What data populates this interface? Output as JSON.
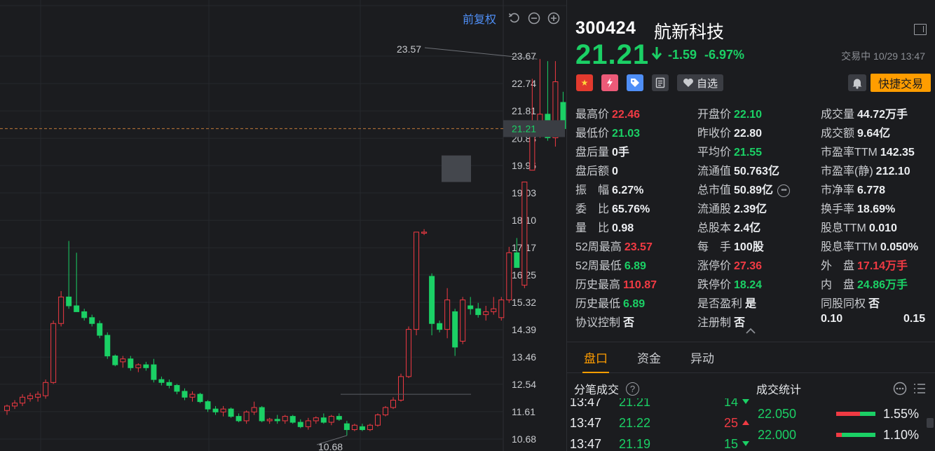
{
  "chart_toolbar": {
    "adjust_label": "前复权"
  },
  "chart_data": {
    "type": "candlestick",
    "y_ticks": [
      23.67,
      22.74,
      21.81,
      20.88,
      19.96,
      19.03,
      18.1,
      17.17,
      16.25,
      15.32,
      14.39,
      13.46,
      12.54,
      11.61,
      10.68
    ],
    "ylim": [
      10.68,
      23.67
    ],
    "current_price": 21.21,
    "max_label": "23.57",
    "min_label": "10.68",
    "colors": {
      "up": "#f03a43",
      "down": "#1bd065",
      "grid": "#26282c",
      "axis_text": "#c9cbcf"
    },
    "candles": [
      [
        11.65,
        11.85,
        11.5,
        11.8
      ],
      [
        11.8,
        12.0,
        11.7,
        11.9
      ],
      [
        11.9,
        12.2,
        11.8,
        12.1
      ],
      [
        12.05,
        12.25,
        11.95,
        12.15
      ],
      [
        12.1,
        12.3,
        11.95,
        12.2
      ],
      [
        12.15,
        12.7,
        12.05,
        12.6
      ],
      [
        12.6,
        14.7,
        12.55,
        14.6
      ],
      [
        14.6,
        15.7,
        14.5,
        15.5
      ],
      [
        15.5,
        17.4,
        15.1,
        15.2
      ],
      [
        15.2,
        17.0,
        15.0,
        15.0
      ],
      [
        15.0,
        15.1,
        14.7,
        14.8
      ],
      [
        14.8,
        14.9,
        14.5,
        14.6
      ],
      [
        14.6,
        14.7,
        14.1,
        14.2
      ],
      [
        14.2,
        14.3,
        13.4,
        13.5
      ],
      [
        13.5,
        13.55,
        13.15,
        13.2
      ],
      [
        13.3,
        13.5,
        13.1,
        13.4
      ],
      [
        13.4,
        13.5,
        13.0,
        13.1
      ],
      [
        13.1,
        13.25,
        12.95,
        13.2
      ],
      [
        13.2,
        13.3,
        13.0,
        13.1
      ],
      [
        13.2,
        13.4,
        12.6,
        12.7
      ],
      [
        12.7,
        12.8,
        12.5,
        12.6
      ],
      [
        12.6,
        12.7,
        12.4,
        12.5
      ],
      [
        12.5,
        12.55,
        12.2,
        12.3
      ],
      [
        12.3,
        12.4,
        12.0,
        12.1
      ],
      [
        12.1,
        12.3,
        11.95,
        12.2
      ],
      [
        12.2,
        12.25,
        11.9,
        11.95
      ],
      [
        11.95,
        12.0,
        11.6,
        11.7
      ],
      [
        11.7,
        11.8,
        11.5,
        11.6
      ],
      [
        11.6,
        11.8,
        11.45,
        11.7
      ],
      [
        11.7,
        11.75,
        11.4,
        11.45
      ],
      [
        11.45,
        11.55,
        11.25,
        11.3
      ],
      [
        11.3,
        11.65,
        11.2,
        11.6
      ],
      [
        11.6,
        11.95,
        11.5,
        11.75
      ],
      [
        11.75,
        11.8,
        11.25,
        11.3
      ],
      [
        11.3,
        11.4,
        11.2,
        11.35
      ],
      [
        11.35,
        11.5,
        11.2,
        11.3
      ],
      [
        11.3,
        11.5,
        11.2,
        11.45
      ],
      [
        11.45,
        11.5,
        11.2,
        11.25
      ],
      [
        11.25,
        11.35,
        11.05,
        11.1
      ],
      [
        11.1,
        11.4,
        11.0,
        11.3
      ],
      [
        11.3,
        11.45,
        11.2,
        11.4
      ],
      [
        11.4,
        11.55,
        11.2,
        11.25
      ],
      [
        11.25,
        11.5,
        11.15,
        11.45
      ],
      [
        11.45,
        11.55,
        11.3,
        11.35
      ],
      [
        11.2,
        11.3,
        10.8,
        11.0
      ],
      [
        11.0,
        11.2,
        10.95,
        11.15
      ],
      [
        11.1,
        11.2,
        10.95,
        11.0
      ],
      [
        11.0,
        11.2,
        10.95,
        11.15
      ],
      [
        11.15,
        11.55,
        11.1,
        11.5
      ],
      [
        11.5,
        11.8,
        11.45,
        11.75
      ],
      [
        11.75,
        12.1,
        11.7,
        12.0
      ],
      [
        12.0,
        12.9,
        11.95,
        12.8
      ],
      [
        12.8,
        14.5,
        12.75,
        14.4
      ],
      [
        14.4,
        17.7,
        14.2,
        17.7
      ],
      [
        17.7,
        17.8,
        17.6,
        17.7
      ],
      [
        16.2,
        16.3,
        14.2,
        14.6
      ],
      [
        14.6,
        14.7,
        14.3,
        14.4
      ],
      [
        14.4,
        15.8,
        14.1,
        15.4
      ],
      [
        15.0,
        15.1,
        13.5,
        13.8
      ],
      [
        14.0,
        15.5,
        13.9,
        15.4
      ],
      [
        15.2,
        15.5,
        14.9,
        15.1
      ],
      [
        15.1,
        15.3,
        14.8,
        14.9
      ],
      [
        14.9,
        15.2,
        14.7,
        15.0
      ],
      [
        15.0,
        15.5,
        14.9,
        15.1
      ],
      [
        14.8,
        15.5,
        14.7,
        15.4
      ],
      [
        15.4,
        17.2,
        15.3,
        17.0
      ],
      [
        17.0,
        17.5,
        16.5,
        16.5
      ],
      [
        15.9,
        19.4,
        15.8,
        19.4
      ],
      [
        19.8,
        22.9,
        19.8,
        21.2
      ],
      [
        21.2,
        23.57,
        20.9,
        21.7
      ],
      [
        21.7,
        23.5,
        20.8,
        20.9
      ],
      [
        20.9,
        23.5,
        20.6,
        22.8
      ],
      [
        22.1,
        22.46,
        21.03,
        21.21
      ]
    ]
  },
  "stock": {
    "code": "300424",
    "name": "航新科技",
    "price": "21.21",
    "change": "-1.59",
    "change_pct": "-6.97%",
    "status": "交易中 10/29 13:47",
    "badge_cn": "★",
    "watchlist_label": "自选",
    "quick_trade_label": "快捷交易"
  },
  "stats": [
    [
      {
        "label": "最高价",
        "value": "22.46",
        "color": "red"
      },
      {
        "label": "开盘价",
        "value": "22.10",
        "color": "green"
      },
      {
        "label": "成交量",
        "value": "44.72万手",
        "color": "white"
      }
    ],
    [
      {
        "label": "最低价",
        "value": "21.03",
        "color": "green"
      },
      {
        "label": "昨收价",
        "value": "22.80",
        "color": "white"
      },
      {
        "label": "成交额",
        "value": "9.64亿",
        "color": "white"
      }
    ],
    [
      {
        "label": "盘后量",
        "value": "0手",
        "color": "white"
      },
      {
        "label": "平均价",
        "value": "21.55",
        "color": "green"
      },
      {
        "label": "市盈率TTM",
        "value": "142.35",
        "color": "white"
      }
    ],
    [
      {
        "label": "盘后额",
        "value": "0",
        "color": "white"
      },
      {
        "label": "流通值",
        "value": "50.763亿",
        "color": "white"
      },
      {
        "label": "市盈率(静)",
        "value": "212.10",
        "color": "white"
      }
    ],
    [
      {
        "label": "振　幅",
        "value": "6.27%",
        "color": "white"
      },
      {
        "label": "总市值",
        "value": "50.89亿",
        "color": "white",
        "more": true
      },
      {
        "label": "市净率",
        "value": "6.778",
        "color": "white"
      }
    ],
    [
      {
        "label": "委　比",
        "value": "65.76%",
        "color": "white"
      },
      {
        "label": "流通股",
        "value": "2.39亿",
        "color": "white"
      },
      {
        "label": "换手率",
        "value": "18.69%",
        "color": "white"
      }
    ],
    [
      {
        "label": "量　比",
        "value": "0.98",
        "color": "white"
      },
      {
        "label": "总股本",
        "value": "2.4亿",
        "color": "white"
      },
      {
        "label": "股息TTM",
        "value": "0.010",
        "color": "white"
      }
    ],
    [
      {
        "label": "52周最高",
        "value": "23.57",
        "color": "red"
      },
      {
        "label": "每　手",
        "value": "100股",
        "color": "white"
      },
      {
        "label": "股息率TTM",
        "value": "0.050%",
        "color": "white"
      }
    ],
    [
      {
        "label": "52周最低",
        "value": "6.89",
        "color": "green"
      },
      {
        "label": "涨停价",
        "value": "27.36",
        "color": "red"
      },
      {
        "label": "外　盘",
        "value": "17.14万手",
        "color": "red"
      }
    ],
    [
      {
        "label": "历史最高",
        "value": "110.87",
        "color": "red"
      },
      {
        "label": "跌停价",
        "value": "18.24",
        "color": "green"
      },
      {
        "label": "内　盘",
        "value": "24.86万手",
        "color": "green"
      }
    ],
    [
      {
        "label": "历史最低",
        "value": "6.89",
        "color": "green"
      },
      {
        "label": "是否盈利",
        "value": "是",
        "color": "white"
      },
      {
        "label": "同股同权",
        "value": "否",
        "color": "white"
      }
    ],
    [
      {
        "label": "协议控制",
        "value": "否",
        "color": "white"
      },
      {
        "label": "注册制",
        "value": "否",
        "color": "white"
      },
      {
        "label": "",
        "value": "0.10",
        "color": "white",
        "extra": "0.15"
      }
    ]
  ],
  "tabs": [
    {
      "label": "盘口",
      "active": true
    },
    {
      "label": "资金",
      "active": false
    },
    {
      "label": "异动",
      "active": false
    }
  ],
  "ticks_panel": {
    "title": "分笔成交",
    "help_icon": "?",
    "rows": [
      {
        "time": "13:47",
        "price": "21.21",
        "vol": "14",
        "dir": "down"
      },
      {
        "time": "13:47",
        "price": "21.22",
        "vol": "25",
        "dir": "up"
      },
      {
        "time": "13:47",
        "price": "21.19",
        "vol": "15",
        "dir": "down"
      }
    ]
  },
  "volume_stats_panel": {
    "title": "成交统计",
    "rows": [
      {
        "price": "22.050",
        "pct": "1.55%",
        "buy": 0.6,
        "sell": 0.4
      },
      {
        "price": "22.000",
        "pct": "1.10%",
        "buy": 0.15,
        "sell": 0.85
      }
    ]
  }
}
